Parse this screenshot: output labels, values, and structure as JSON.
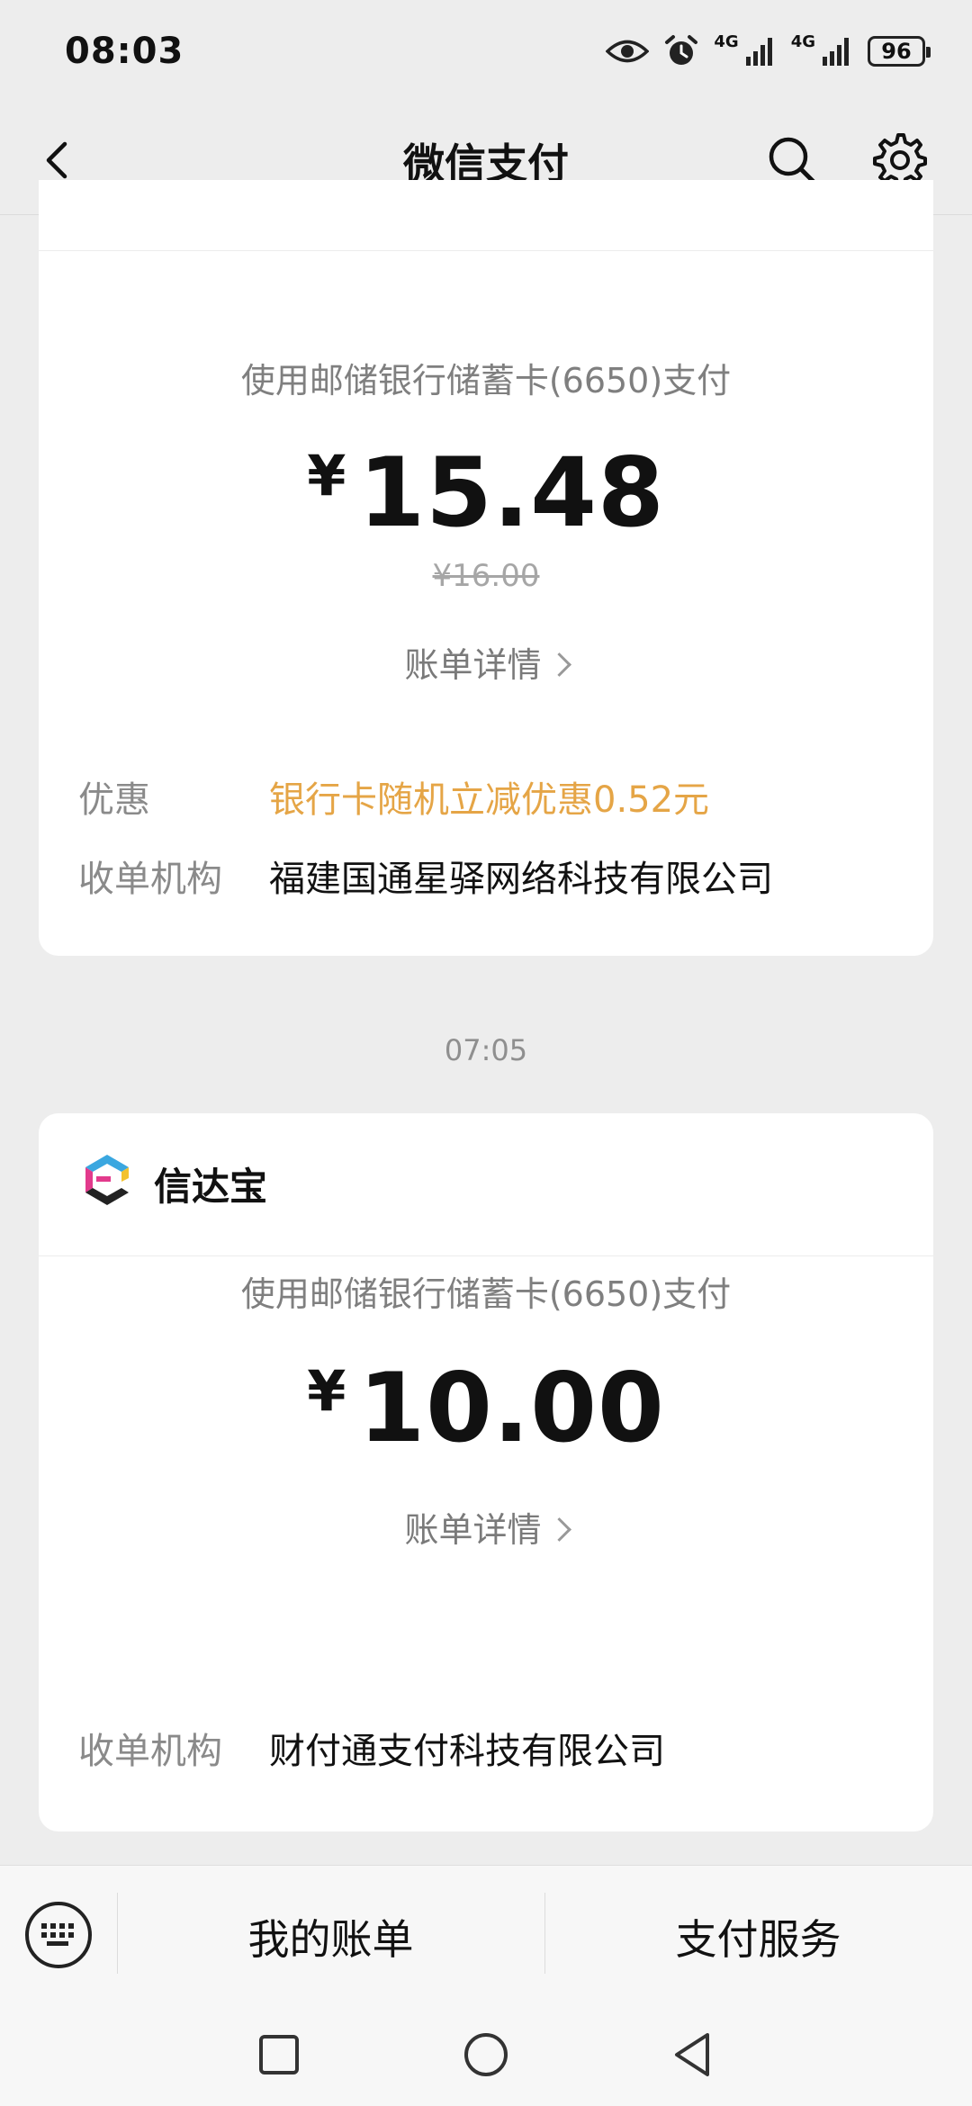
{
  "status_bar": {
    "time": "08:03",
    "network_1": "4G",
    "network_2": "4G",
    "battery": "96"
  },
  "nav": {
    "title": "微信支付"
  },
  "cards": [
    {
      "payment_method": "使用邮储银行储蓄卡(6650)支付",
      "currency": "¥",
      "amount": "15.48",
      "original_price": "¥16.00",
      "bill_detail": "账单详情",
      "rows": [
        {
          "label": "优惠",
          "value": "银行卡随机立减优惠0.52元",
          "highlight": "#e5a546"
        },
        {
          "label": "收单机构",
          "value": "福建国通星驿网络科技有限公司"
        }
      ]
    },
    {
      "merchant_name": "信达宝",
      "payment_method": "使用邮储银行储蓄卡(6650)支付",
      "currency": "¥",
      "amount": "10.00",
      "bill_detail": "账单详情",
      "rows": [
        {
          "label": "收单机构",
          "value": "财付通支付科技有限公司"
        }
      ]
    }
  ],
  "timestamp": "07:05",
  "bottom_tabs": [
    {
      "label": "我的账单"
    },
    {
      "label": "支付服务"
    }
  ],
  "icons": {
    "back": "chevron-left-icon",
    "search": "search-icon",
    "settings": "gear-icon",
    "keyboard": "keyboard-icon"
  }
}
